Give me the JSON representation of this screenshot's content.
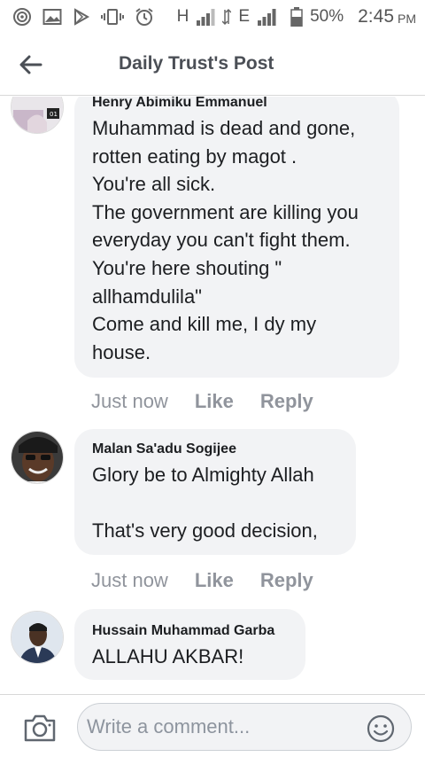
{
  "status_bar": {
    "network_label": "H",
    "network_label_2": "E",
    "battery": "50%",
    "time": "2:45",
    "ampm": "PM"
  },
  "header": {
    "title": "Daily Trust's Post"
  },
  "comments": [
    {
      "author": "Henry Abimiku Emmanuel",
      "text": "Muhammad is dead and gone,\nrotten eating by magot .\n You're all sick.\nThe government are killing you\neveryday you can't fight them.\nYou're here shouting \"\nallhamdulila\"\nCome and kill me, I dy my\nhouse.",
      "time": "Just now",
      "like": "Like",
      "reply": "Reply"
    },
    {
      "author": "Malan Sa'adu Sogijee",
      "text": "Glory be to Almighty Allah\n\nThat's very good decision,",
      "time": "Just now",
      "like": "Like",
      "reply": "Reply"
    },
    {
      "author": "Hussain Muhammad Garba",
      "text": "ALLAHU AKBAR!"
    }
  ],
  "composer": {
    "placeholder": "Write a comment..."
  },
  "icons": {
    "back": "arrow-left-icon",
    "camera": "camera-icon",
    "emoji": "smiley-icon"
  },
  "colors": {
    "bubble": "#f2f3f5",
    "action_text": "#90949c",
    "title_text": "#4b4f56"
  }
}
